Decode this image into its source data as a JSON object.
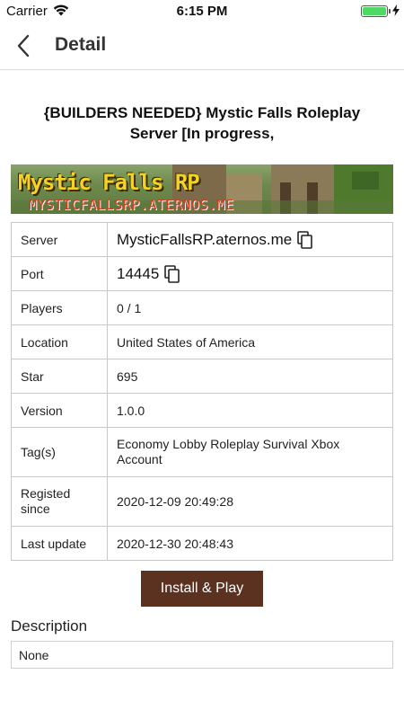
{
  "status": {
    "carrier": "Carrier",
    "time": "6:15 PM"
  },
  "nav": {
    "title": "Detail"
  },
  "server": {
    "title": "{BUILDERS NEEDED} Mystic Falls Roleplay Server [In progress,",
    "banner_title": "Mystic Falls RP",
    "banner_subtitle": "MYSTICFALLSRP.ATERNOS.ME"
  },
  "table": {
    "rows": [
      {
        "key": "Server",
        "value": "MysticFallsRP.aternos.me"
      },
      {
        "key": "Port",
        "value": "14445"
      },
      {
        "key": "Players",
        "value": "0 / 1"
      },
      {
        "key": "Location",
        "value": "United States of America"
      },
      {
        "key": "Star",
        "value": "695"
      },
      {
        "key": "Version",
        "value": "1.0.0"
      },
      {
        "key": "Tag(s)",
        "value": "Economy Lobby Roleplay Survival Xbox Account"
      },
      {
        "key": "Registed since",
        "value": "2020-12-09 20:49:28"
      },
      {
        "key": "Last update",
        "value": "2020-12-30 20:48:43"
      }
    ]
  },
  "actions": {
    "install_label": "Install & Play"
  },
  "description": {
    "label": "Description",
    "text": "None"
  },
  "colors": {
    "button_bg": "#5b3220",
    "battery": "#4cd964",
    "banner_title": "#f3d324",
    "banner_subtitle": "#d9391e"
  },
  "icons": {
    "back": "chevron-left-icon",
    "copy": "copy-icon",
    "wifi": "wifi-icon",
    "battery": "battery-icon"
  }
}
